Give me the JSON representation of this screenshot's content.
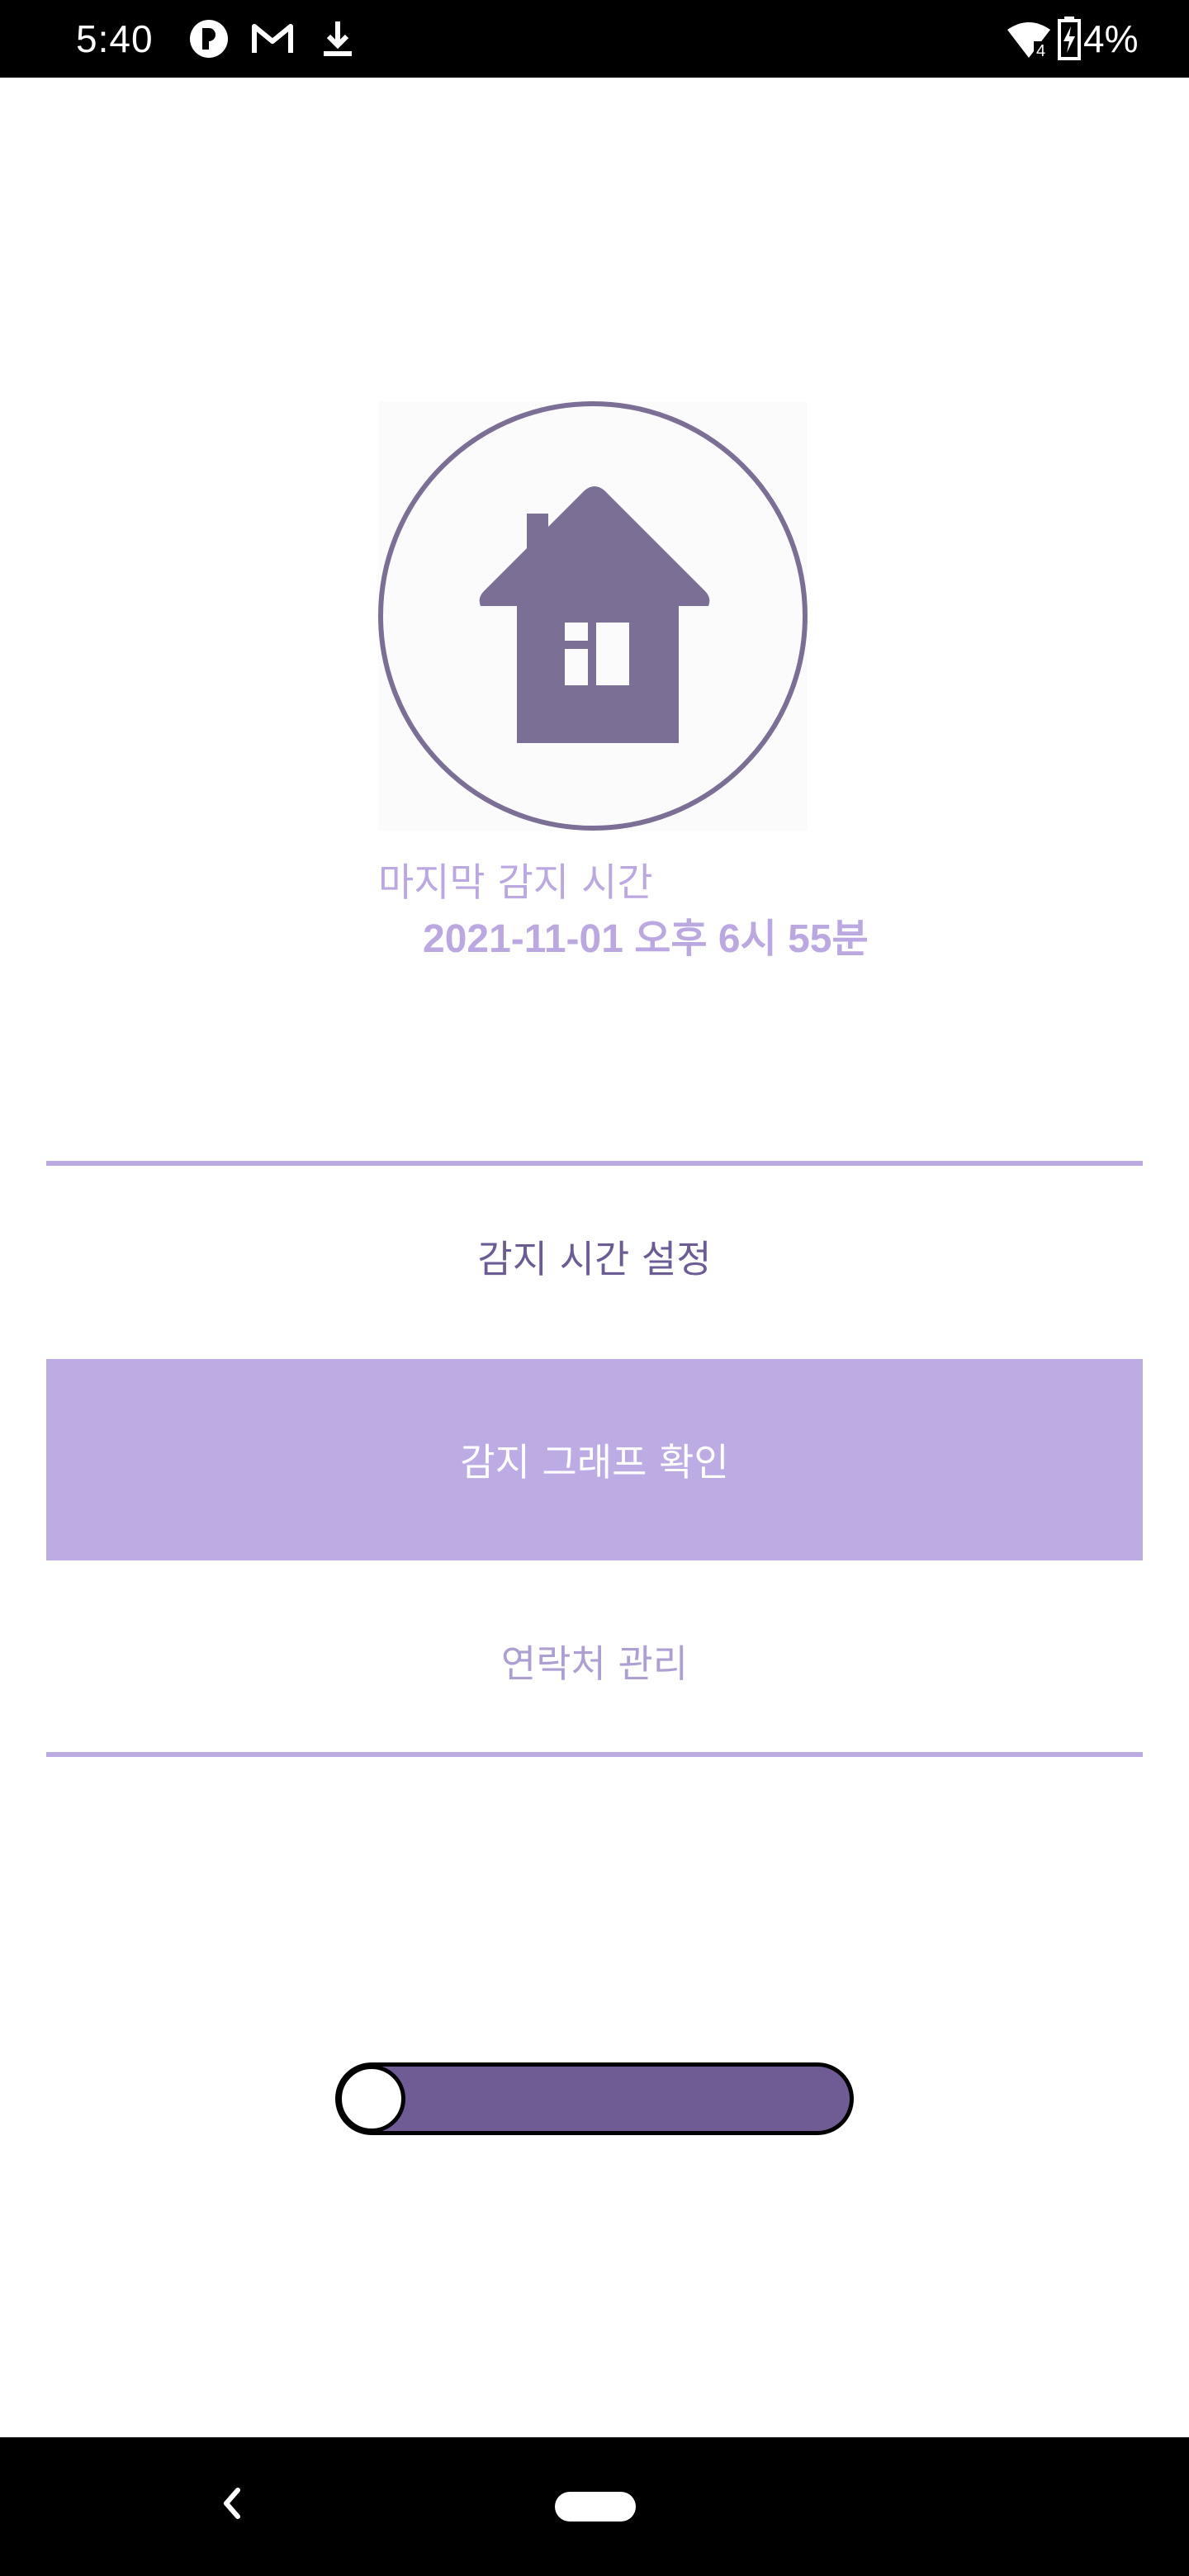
{
  "status_bar": {
    "time": "5:40",
    "battery_percent": "4%",
    "wifi_badge": "4",
    "icons": [
      "circle-app-icon",
      "gmail-icon",
      "download-icon",
      "wifi-icon",
      "battery-charging-icon"
    ]
  },
  "detection": {
    "last_label": "마지막 감지 시간",
    "last_time": "2021-11-01 오후 6시 55분",
    "icon": "home-icon"
  },
  "menu": {
    "time_setting": "감지 시간 설정",
    "graph": "감지 그래프 확인",
    "contacts": "연락처 관리"
  },
  "toggle": {
    "state": "on"
  },
  "nav": {
    "icons": [
      "back-icon",
      "home-pill-icon"
    ]
  },
  "colors": {
    "accent": "#bdace4",
    "dark_accent": "#705c95",
    "icon_color": "#7b6f96"
  }
}
